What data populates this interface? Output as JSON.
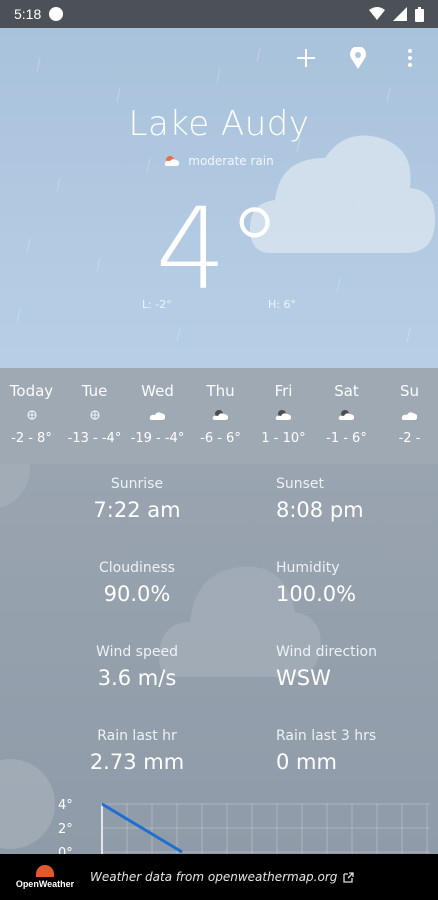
{
  "status_bar": {
    "time": "5:18"
  },
  "header": {
    "city": "Lake Audy",
    "condition": "moderate rain",
    "temperature": "4°",
    "low": "L: -2°",
    "high": "H: 6°",
    "icons": [
      "add-icon",
      "location-pin-icon",
      "more-vert-icon"
    ]
  },
  "forecast": [
    {
      "day": "Today",
      "icon": "snowflake-icon",
      "range": "-2 - 8°"
    },
    {
      "day": "Tue",
      "icon": "snowflake-icon",
      "range": "-13 - -4°"
    },
    {
      "day": "Wed",
      "icon": "cloud-icon",
      "range": "-19 - -4°"
    },
    {
      "day": "Thu",
      "icon": "cloud-sun-icon",
      "range": "-6 - 6°"
    },
    {
      "day": "Fri",
      "icon": "cloud-sun-icon",
      "range": "1 - 10°"
    },
    {
      "day": "Sat",
      "icon": "cloud-sun-icon",
      "range": "-1 - 6°"
    },
    {
      "day": "Su",
      "icon": "cloud-icon",
      "range": "-2 -"
    }
  ],
  "details": {
    "sunrise": {
      "label": "Sunrise",
      "value": "7:22 am"
    },
    "sunset": {
      "label": "Sunset",
      "value": "8:08 pm"
    },
    "cloudiness": {
      "label": "Cloudiness",
      "value": "90.0%"
    },
    "humidity": {
      "label": "Humidity",
      "value": "100.0%"
    },
    "wind_speed": {
      "label": "Wind speed",
      "value": "3.6 m/s"
    },
    "wind_direction": {
      "label": "Wind direction",
      "value": "WSW"
    },
    "rain_1h": {
      "label": "Rain last hr",
      "value": "2.73 mm"
    },
    "rain_3h": {
      "label": "Rain last 3 hrs",
      "value": "0 mm"
    }
  },
  "chart_data": {
    "type": "line",
    "y_tick_labels": [
      "4°",
      "2°",
      "0°"
    ],
    "series": [
      {
        "values": [
          4,
          2,
          0
        ]
      }
    ]
  },
  "footer": {
    "brand": "OpenWeather",
    "credit": "Weather data from openweathermap.org"
  },
  "colors": {
    "line": "#1e6fd0",
    "footer_brand": "#e15a2f"
  }
}
